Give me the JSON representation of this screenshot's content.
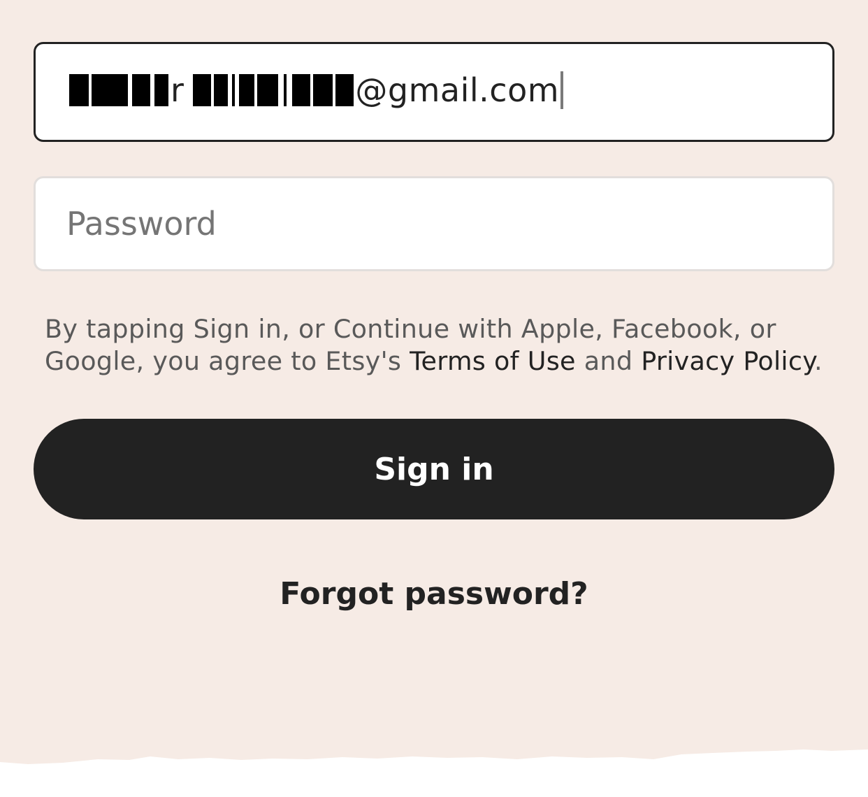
{
  "colors": {
    "background": "#f6ebe5",
    "field_background": "#ffffff",
    "focused_border": "#222222",
    "idle_border": "#e2dedc",
    "primary_button": "#222222",
    "primary_button_text": "#ffffff",
    "legal_text": "#595959",
    "link_text": "#222222"
  },
  "email_field": {
    "visible_character": "r",
    "domain_suffix": "@gmail.com",
    "redacted": true,
    "focused": true
  },
  "password_field": {
    "placeholder": "Password",
    "value": ""
  },
  "legal": {
    "prefix": "By tapping Sign in, or Continue with Apple, Facebook, or Google, you agree to Etsy's ",
    "terms_link": "Terms of Use",
    "conjunction": " and ",
    "privacy_link": "Privacy Policy",
    "suffix": "."
  },
  "buttons": {
    "sign_in": "Sign in",
    "forgot_password": "Forgot password?"
  }
}
